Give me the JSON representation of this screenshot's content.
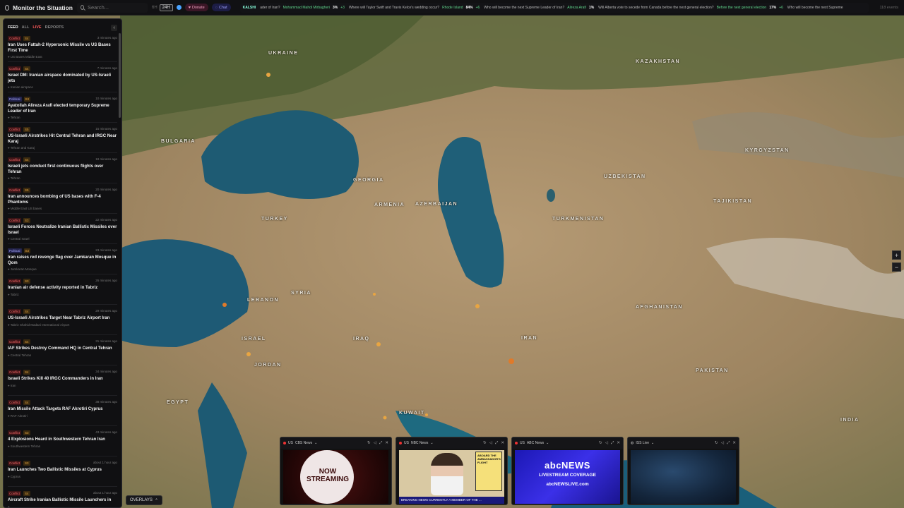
{
  "app": {
    "title": "Monitor the Situation"
  },
  "search": {
    "placeholder": "Search..."
  },
  "topbar": {
    "range_label": "6H",
    "range_active": "24H",
    "donate_label": "Donate",
    "chat_label": "Chat",
    "event_count": "118 events"
  },
  "ticker": {
    "tag": "KALSHI",
    "items": [
      {
        "q": "ader of Iran?",
        "a": "Mohammad Mahdi Mirbagheri",
        "pct": "3%",
        "chg": "+3"
      },
      {
        "q": "Where will Taylor Swift and Travis Kelce's wedding occur?",
        "a": "Rhode Island",
        "pct": "84%",
        "chg": "+6"
      },
      {
        "q": "Who will become the next Supreme Leader of Iran?",
        "a": "Alireza Arafi",
        "pct": "1%",
        "chg": ""
      },
      {
        "q": "Will Alberta vote to secede from Canada before the next general election?",
        "a": "Before the next general election",
        "pct": "17%",
        "chg": "+6"
      },
      {
        "q": "Who will become the next Supreme",
        "a": "",
        "pct": "",
        "chg": ""
      }
    ]
  },
  "sidebar": {
    "tabs": {
      "feed": "FEED",
      "all": "ALL",
      "live": "LIVE",
      "reports": "REPORTS"
    },
    "collapse_icon": "‹",
    "items": [
      {
        "badge": "Conflict",
        "sev": "S4",
        "time": "3 minutes ago",
        "title": "Iran Uses Fattah-2 Hypersonic Missile vs US Bases First Time",
        "loc": "US Bases Middle East"
      },
      {
        "badge": "Conflict",
        "sev": "S4",
        "time": "7 minutes ago",
        "title": "Israel DM: Iranian airspace dominated by US-Israeli jets",
        "loc": "Iranian airspace"
      },
      {
        "badge": "Political",
        "sev": "S3",
        "time": "10 minutes ago",
        "title": "Ayatollah Alireza Arafi elected temporary Supreme Leader of Iran",
        "loc": "Tehran"
      },
      {
        "badge": "Conflict",
        "sev": "S5",
        "time": "15 minutes ago",
        "title": "US-Israeli Airstrikes Hit Central Tehran and IRGC Near Karaj",
        "loc": "Tehran and Karaj"
      },
      {
        "badge": "Conflict",
        "sev": "S4",
        "time": "18 minutes ago",
        "title": "Israeli jets conduct first continuous flights over Tehran",
        "loc": "Tehran"
      },
      {
        "badge": "Conflict",
        "sev": "S5",
        "time": "20 minutes ago",
        "title": "Iran announces bombing of US bases with F-4 Phantoms",
        "loc": "Middle East US bases"
      },
      {
        "badge": "Conflict",
        "sev": "S3",
        "time": "22 minutes ago",
        "title": "Israeli Forces Neutralize Iranian Ballistic Missiles over Israel",
        "loc": "Central Israel"
      },
      {
        "badge": "Political",
        "sev": "S3",
        "time": "23 minutes ago",
        "title": "Iran raises red revenge flag over Jamkaran Mosque in Qom",
        "loc": "Jamkaran Mosque"
      },
      {
        "badge": "Conflict",
        "sev": "S3",
        "time": "26 minutes ago",
        "title": "Iranian air defense activity reported in Tabriz",
        "loc": "Tabriz"
      },
      {
        "badge": "Conflict",
        "sev": "S4",
        "time": "29 minutes ago",
        "title": "US-Israeli Airstrikes Target Near Tabriz Airport Iran",
        "loc": "Tabriz Shahid Madani International Airport"
      },
      {
        "badge": "Conflict",
        "sev": "S4",
        "time": "31 minutes ago",
        "title": "IAF Strikes Destroy Command HQ in Central Tehran",
        "loc": "Central Tehran"
      },
      {
        "badge": "Conflict",
        "sev": "S4",
        "time": "34 minutes ago",
        "title": "Israeli Strikes Kill 40 IRGC Commanders in Iran",
        "loc": "Iran"
      },
      {
        "badge": "Conflict",
        "sev": "S4",
        "time": "38 minutes ago",
        "title": "Iran Missile Attack Targets RAF Akrotiri Cyprus",
        "loc": "RAF Akrotiri"
      },
      {
        "badge": "Conflict",
        "sev": "S3",
        "time": "43 minutes ago",
        "title": "4 Explosions Heard in Southwestern Tehran Iran",
        "loc": "Southwestern Tehran"
      },
      {
        "badge": "Conflict",
        "sev": "S3",
        "time": "about 1 hour ago",
        "title": "Iran Launches Two Ballistic Missiles at Cyprus",
        "loc": "Cyprus"
      },
      {
        "badge": "Conflict",
        "sev": "S4",
        "time": "about 1 hour ago",
        "title": "Aircraft Strike Iranian Ballistic Missile Launchers in",
        "loc": ""
      }
    ]
  },
  "overlays": {
    "label": "OVERLAYS",
    "icon": "chevron-up-icon"
  },
  "zoom": {
    "in": "+",
    "out": "−"
  },
  "map": {
    "labels": {
      "ukraine": "UKRAINE",
      "bulgaria": "BULGARIA",
      "georgia": "GEORGIA",
      "armenia": "ARMENIA",
      "azerbaijan": "AZERBAIJAN",
      "turkey": "TURKEY",
      "syria": "SYRIA",
      "lebanon": "LEBANON",
      "israel": "ISRAEL",
      "jordan": "JORDAN",
      "iraq": "IRAQ",
      "iran": "IRAN",
      "egypt": "EGYPT",
      "kazakhstan": "KAZAKHSTAN",
      "uzbekistan": "UZBEKISTAN",
      "turkmenistan": "TURKMENISTAN",
      "afghanistan": "AFGHANISTAN",
      "pakistan": "PAKISTAN",
      "india": "INDIA",
      "kyrgyzstan": "KYRGYZSTAN",
      "tajikistan": "TAJIKISTAN",
      "kuwait": "KUWAIT"
    }
  },
  "videos": [
    {
      "country": "US",
      "name": "CBS News",
      "text": "NOW STREAMING"
    },
    {
      "country": "US",
      "name": "NBC News",
      "text": "BREAKING NEWS  CURRENTLY A MEMBER OF THE ...",
      "box": "ABOARD THE AMBASSADOR'S FLIGHT"
    },
    {
      "country": "US",
      "name": "ABC News",
      "logo": "abcNEWS",
      "sub": "LIVESTREAM COVERAGE",
      "url": "abcNEWSLIVE.com"
    },
    {
      "country": "",
      "name": "ISS Live"
    }
  ],
  "colors": {
    "accent_live": "#ff5a5a",
    "conflict": "#ff6b6b",
    "political": "#a8a8ff"
  }
}
